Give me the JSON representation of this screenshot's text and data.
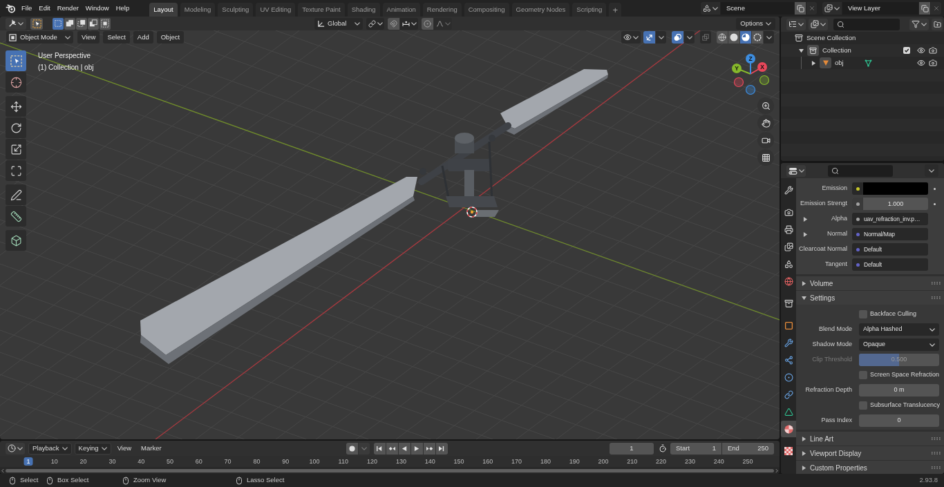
{
  "menu_bar": {
    "items": [
      "File",
      "Edit",
      "Render",
      "Window",
      "Help"
    ]
  },
  "workspaces": {
    "tabs": [
      {
        "label": "Layout",
        "selected": true
      },
      {
        "label": "Modeling",
        "selected": false
      },
      {
        "label": "Sculpting",
        "selected": false
      },
      {
        "label": "UV Editing",
        "selected": false
      },
      {
        "label": "Texture Paint",
        "selected": false
      },
      {
        "label": "Shading",
        "selected": false
      },
      {
        "label": "Animation",
        "selected": false
      },
      {
        "label": "Rendering",
        "selected": false
      },
      {
        "label": "Compositing",
        "selected": false
      },
      {
        "label": "Geometry Nodes",
        "selected": false
      },
      {
        "label": "Scripting",
        "selected": false
      }
    ],
    "add_label": "+"
  },
  "scene_selector": {
    "value": "Scene"
  },
  "view_layer_selector": {
    "value": "View Layer"
  },
  "tool_header": {
    "select_modes": [
      {
        "selected": true
      },
      {
        "selected": false
      },
      {
        "selected": false
      },
      {
        "selected": false
      },
      {
        "selected": false
      }
    ],
    "orientation": "Global",
    "options": "Options"
  },
  "viewport_header": {
    "mode": "Object Mode",
    "menus": [
      "View",
      "Select",
      "Add",
      "Object"
    ],
    "gizmos_on": true,
    "overlays_on": true,
    "xray_on": false,
    "shading_modes": [
      {
        "selected": false
      },
      {
        "selected": false
      },
      {
        "selected": true
      },
      {
        "selected": false
      }
    ]
  },
  "viewport": {
    "view_name": "User Perspective",
    "info": "(1) Collection | obj",
    "tool_groups": [
      [
        {
          "kind": "select",
          "selected": true
        },
        {
          "kind": "cursor",
          "selected": false
        }
      ],
      [
        {
          "kind": "move",
          "selected": false
        },
        {
          "kind": "rotate",
          "selected": false
        },
        {
          "kind": "scale",
          "selected": false
        },
        {
          "kind": "transform",
          "selected": false
        }
      ],
      [
        {
          "kind": "annotate",
          "selected": false
        },
        {
          "kind": "measure",
          "selected": false
        }
      ],
      [
        {
          "kind": "add_cube",
          "selected": false
        }
      ]
    ],
    "gizmo_axes": [
      {
        "label": "X",
        "color": "#e8475a"
      },
      {
        "label": "Y",
        "color": "#86b82b"
      },
      {
        "label": "Z",
        "color": "#3d8de0"
      }
    ]
  },
  "outliner": {
    "items": [
      {
        "label": "Scene Collection",
        "kind": "scene",
        "children": [
          {
            "label": "Collection",
            "kind": "collection",
            "expanded": true,
            "checked": true,
            "children": [
              {
                "label": "obj",
                "kind": "object",
                "expanded": false
              }
            ]
          }
        ]
      }
    ]
  },
  "properties": {
    "tab_groups": [
      [
        {
          "kind": "tool",
          "selected": false
        }
      ],
      [
        {
          "kind": "render",
          "selected": false
        },
        {
          "kind": "output",
          "selected": false
        },
        {
          "kind": "view_layer",
          "selected": false
        },
        {
          "kind": "scene",
          "selected": false
        },
        {
          "kind": "world",
          "selected": false
        }
      ],
      [
        {
          "kind": "collection",
          "selected": false
        }
      ],
      [
        {
          "kind": "object",
          "selected": false
        },
        {
          "kind": "modifiers",
          "selected": false
        },
        {
          "kind": "particles",
          "selected": false
        },
        {
          "kind": "physics",
          "selected": false
        },
        {
          "kind": "constraints",
          "selected": false
        },
        {
          "kind": "data",
          "selected": false
        },
        {
          "kind": "material",
          "selected": true
        }
      ],
      [
        {
          "kind": "texture",
          "selected": false
        }
      ]
    ],
    "inputs": [
      {
        "label": "Emission",
        "kind": "color",
        "color": "#c7c729",
        "swatch": {
          "color": "#000000"
        },
        "expandable": false,
        "decorator": true
      },
      {
        "label": "Emission Strengt",
        "kind": "number",
        "color": "#a1a1a1",
        "value": "1.000",
        "expandable": false,
        "decorator": true
      },
      {
        "label": "Alpha",
        "kind": "link",
        "color": "#a1a1a1",
        "value": "uav_refraction_inv.p…",
        "expandable": true,
        "decorator": false
      },
      {
        "label": "Normal",
        "kind": "link",
        "color": "#6363c7",
        "value": "Normal/Map",
        "expandable": true,
        "decorator": false
      },
      {
        "label": "Clearcoat Normal",
        "kind": "link",
        "color": "#6363c7",
        "value": "Default",
        "expandable": false,
        "decorator": false
      },
      {
        "label": "Tangent",
        "kind": "link",
        "color": "#6363c7",
        "value": "Default",
        "expandable": false,
        "decorator": false
      }
    ],
    "panels": [
      {
        "title": "Volume",
        "expanded": false
      },
      {
        "title": "Settings",
        "expanded": true,
        "rows": [
          {
            "kind": "checkbox",
            "label": "Backface Culling",
            "checked": false
          },
          {
            "kind": "dropdown",
            "label": "Blend Mode",
            "value": "Alpha Hashed"
          },
          {
            "kind": "dropdown",
            "label": "Shadow Mode",
            "value": "Opaque"
          },
          {
            "kind": "slider",
            "label": "Clip Threshold",
            "value": "0.500",
            "level": 0.5,
            "disabled": true
          },
          {
            "kind": "checkbox",
            "label": "Screen Space Refraction",
            "checked": false
          },
          {
            "kind": "number",
            "label": "Refraction Depth",
            "value": "0 m"
          },
          {
            "kind": "checkbox",
            "label": "Subsurface Translucency",
            "checked": false
          },
          {
            "kind": "number",
            "label": "Pass Index",
            "value": "0"
          }
        ]
      },
      {
        "title": "Line Art",
        "expanded": false
      },
      {
        "title": "Viewport Display",
        "expanded": false
      },
      {
        "title": "Custom Properties",
        "expanded": false
      }
    ]
  },
  "timeline": {
    "menus": [
      {
        "label": "Playback",
        "dropdown": true
      },
      {
        "label": "Keying",
        "dropdown": true
      },
      {
        "label": "View",
        "dropdown": false
      },
      {
        "label": "Marker",
        "dropdown": false
      }
    ],
    "current_frame": "1",
    "start_label": "Start",
    "start": "1",
    "end_label": "End",
    "end": "250",
    "frames": [
      {
        "label": "1",
        "selected": true
      },
      {
        "label": "10",
        "selected": false
      },
      {
        "label": "20",
        "selected": false
      },
      {
        "label": "30",
        "selected": false
      },
      {
        "label": "40",
        "selected": false
      },
      {
        "label": "50",
        "selected": false
      },
      {
        "label": "60",
        "selected": false
      },
      {
        "label": "70",
        "selected": false
      },
      {
        "label": "80",
        "selected": false
      },
      {
        "label": "90",
        "selected": false
      },
      {
        "label": "100",
        "selected": false
      },
      {
        "label": "110",
        "selected": false
      },
      {
        "label": "120",
        "selected": false
      },
      {
        "label": "130",
        "selected": false
      },
      {
        "label": "140",
        "selected": false
      },
      {
        "label": "150",
        "selected": false
      },
      {
        "label": "160",
        "selected": false
      },
      {
        "label": "170",
        "selected": false
      },
      {
        "label": "180",
        "selected": false
      },
      {
        "label": "190",
        "selected": false
      },
      {
        "label": "200",
        "selected": false
      },
      {
        "label": "210",
        "selected": false
      },
      {
        "label": "220",
        "selected": false
      },
      {
        "label": "230",
        "selected": false
      },
      {
        "label": "240",
        "selected": false
      },
      {
        "label": "250",
        "selected": false
      }
    ]
  },
  "status_bar": {
    "hints": [
      "Select",
      "Box Select",
      "Zoom View",
      "Lasso Select"
    ],
    "version": "2.93.8"
  }
}
